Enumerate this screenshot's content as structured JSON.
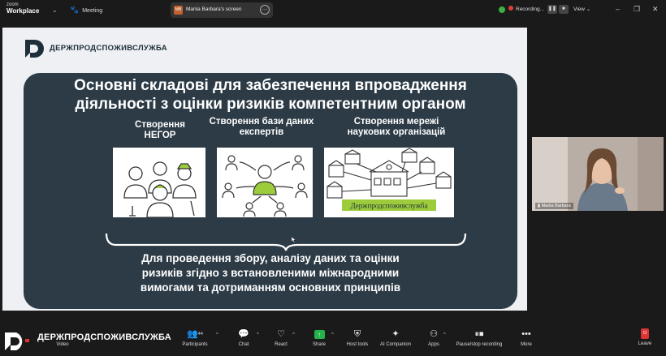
{
  "topbar": {
    "brand_line1": "zoom",
    "brand_line2": "Workplace",
    "meeting_label": "Meeting",
    "share_initials": "MB",
    "share_label": "Mariia Barbara's screen",
    "recording_label": "Recording...",
    "view_label": "View"
  },
  "slide": {
    "logo_text": "ДЕРЖПРОДСПОЖИВСЛУЖБА",
    "title_line1": "Основні складові для забезпечення впровадження",
    "title_line2": "діяльності з оцінки ризиків компетентним органом",
    "columns": [
      {
        "line1": "Створення",
        "line2": "НЕГОР"
      },
      {
        "line1": "Створення бази даних",
        "line2": "експертів"
      },
      {
        "line1": "Створення мережі",
        "line2": "наукових організацій"
      }
    ],
    "network_caption": "Держпродспоживслужба",
    "bottom_line1": "Для проведення збору, аналізу даних та оцінки",
    "bottom_line2": "ризиків згідно з встановленими міжнародними",
    "bottom_line3": "вимогами та  дотриманням основних принципів"
  },
  "camera": {
    "name": "Mariia Barbara"
  },
  "toolbar": {
    "org_name": "ДЕРЖПРОДСПОЖИВСЛУЖБА",
    "video_label": "Video",
    "participants_label": "Participants",
    "participants_count": "44",
    "chat_label": "Chat",
    "react_label": "React",
    "share_label": "Share",
    "host_tools_label": "Host tools",
    "ai_label": "AI Companion",
    "apps_label": "Apps",
    "pause_label": "Pause/stop recording",
    "more_label": "More",
    "leave_label": "Leave"
  },
  "colors": {
    "panel": "#2c3b46",
    "slide_bg": "#eef0f3",
    "share_green": "#24b34a",
    "record_red": "#e03c3c",
    "accent_green": "#9ccc3c"
  }
}
